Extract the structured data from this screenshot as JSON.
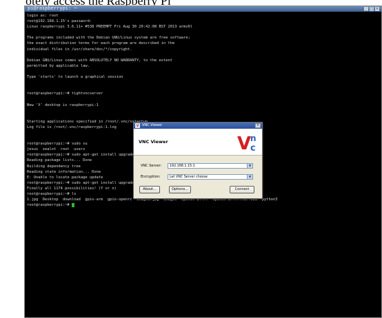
{
  "caption": "otely access the Raspberry Pi",
  "terminal": {
    "title": "pi@raspberrypi: ~",
    "lines": [
      "login as: root",
      "root@192.168.1.15's password:",
      "Linux raspberrypi 3.6.11+ #538 PREEMPT Fri Aug 30 20:42:08 BST 2013 armv6l",
      "",
      "The programs included with the Debian GNU/Linux system are free software;",
      "the exact distribution terms for each program are described in the",
      "individual files in /usr/share/doc/*/copyright.",
      "",
      "Debian GNU/Linux comes with ABSOLUTELY NO WARRANTY, to the extent",
      "permitted by applicable law.",
      "",
      "Type 'startx' to launch a graphical session",
      "",
      "",
      "root@raspberrypi:~# tightvncserver",
      "",
      "New 'X' desktop is raspberrypi:1",
      "",
      "",
      "Starting applications specified in /root/.vnc/xstartup",
      "Log file is /root/.vnc/raspberrypi:1.log",
      "",
      "",
      "root@raspberrypi:~# sudo su",
      "jesus  zealot  root  users",
      "root@raspberrypi:~# sudo apt-get install upgrade",
      "Reading package lists... Done",
      "Building dependency tree",
      "Reading state information... Done",
      "E: Unable to locate package update",
      "root@raspberrypi:~# sudo apt-get install upgrade-system",
      "Finally all 1174 possibilities! (Y or n)",
      "root@raspberrypi:~# ls",
      "1.jpg  Desktop  download  gpio-arm  gpio-openrc  image1.jpg  images  OpenCV-2.4.7  OpenCV-2.4.7.tar.bz2  python3",
      "root@raspberrypi:~# "
    ]
  },
  "vnc": {
    "window_title": "VNC Viewer",
    "header_title": "VNC Viewer",
    "server_label": "VNC Server:",
    "server_value": "192.168.1.15:1",
    "encryption_label": "Encryption:",
    "encryption_value": "Let VNC Server choose",
    "about_label": "About...",
    "options_label": "Options...",
    "connect_label": "Connect",
    "logo_letters": [
      "V",
      "n",
      "c"
    ],
    "colors": {
      "v": "#d42020",
      "n": "#2a64c8",
      "c": "#2a64c8",
      "titlebar": "#2a4f98"
    }
  }
}
